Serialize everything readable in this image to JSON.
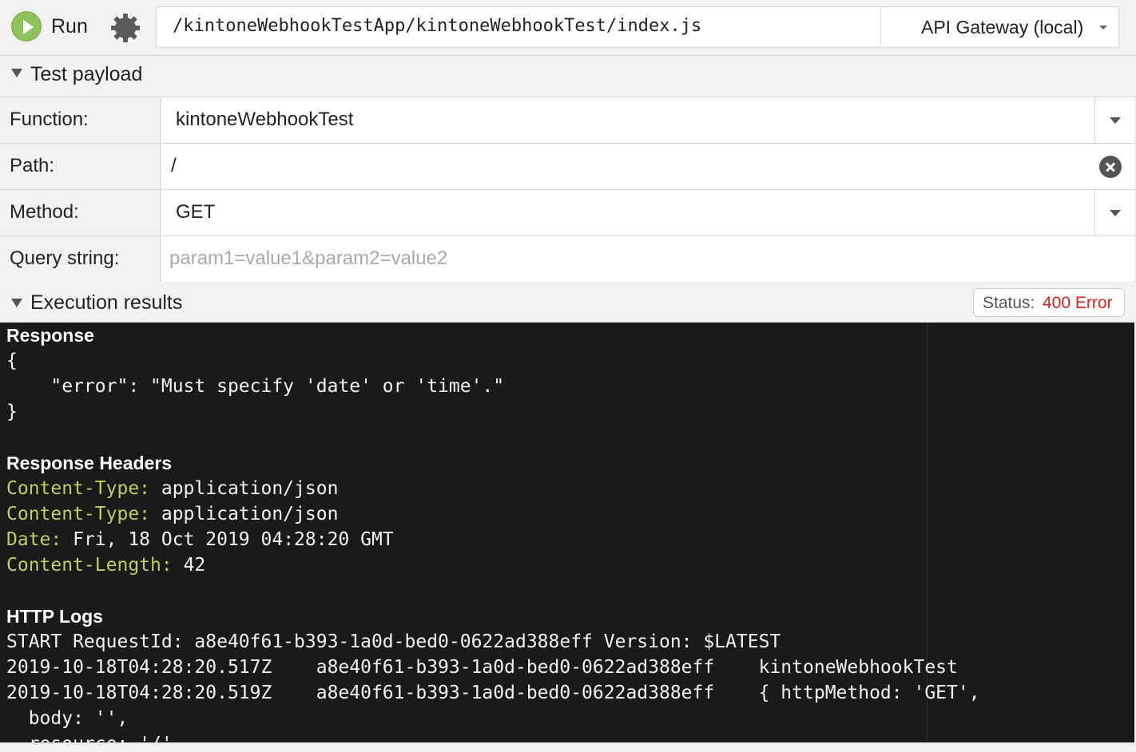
{
  "toolbar": {
    "run_label": "Run",
    "handler_path": "/kintoneWebhookTestApp/kintoneWebhookTest/index.js",
    "environment": "API Gateway (local)"
  },
  "test_payload": {
    "title": "Test payload",
    "function_label": "Function:",
    "function_value": "kintoneWebhookTest",
    "path_label": "Path:",
    "path_value": "/",
    "method_label": "Method:",
    "method_value": "GET",
    "query_label": "Query string:",
    "query_placeholder": "param1=value1&param2=value2"
  },
  "execution": {
    "title": "Execution results",
    "status_label": "Status:",
    "status_value": "400 Error",
    "status_color": "#e0201a"
  },
  "output": {
    "response_heading": "Response",
    "response_lines": [
      "{",
      "    \"error\": \"Must specify 'date' or 'time'.\"",
      "}"
    ],
    "headers_heading": "Response Headers",
    "headers": [
      {
        "key": "Content-Type:",
        "value": " application/json"
      },
      {
        "key": "Content-Type:",
        "value": " application/json"
      },
      {
        "key": "Date:",
        "value": " Fri, 18 Oct 2019 04:28:20 GMT"
      },
      {
        "key": "Content-Length:",
        "value": " 42"
      }
    ],
    "logs_heading": "HTTP Logs",
    "log_lines": [
      "START RequestId: a8e40f61-b393-1a0d-bed0-0622ad388eff Version: $LATEST",
      "2019-10-18T04:28:20.517Z    a8e40f61-b393-1a0d-bed0-0622ad388eff    kintoneWebhookTest",
      "2019-10-18T04:28:20.519Z    a8e40f61-b393-1a0d-bed0-0622ad388eff    { httpMethod: 'GET',",
      "  body: '',",
      "  resource: '/',"
    ]
  },
  "colors": {
    "run_green": "#8cc35a",
    "header_key": "#b9d25e",
    "terminal_bg": "#1a1a1a"
  }
}
